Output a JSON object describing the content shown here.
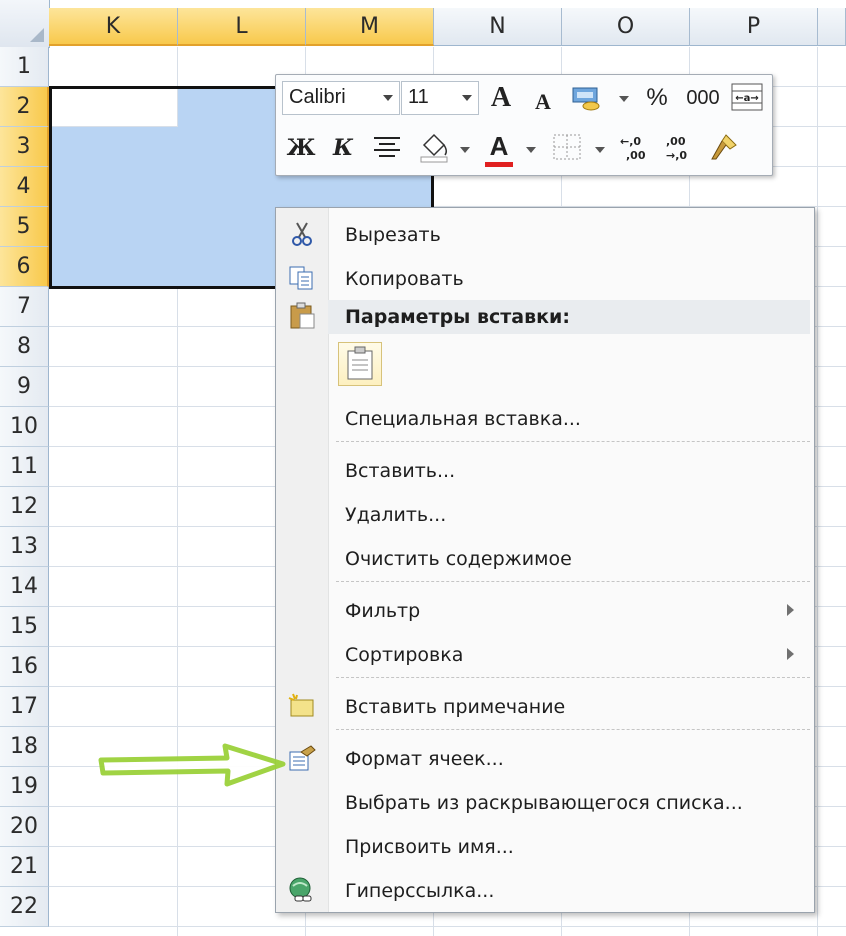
{
  "columns": [
    "K",
    "L",
    "M",
    "N",
    "O",
    "P"
  ],
  "rows": [
    "1",
    "2",
    "3",
    "4",
    "5",
    "6",
    "7",
    "8",
    "9",
    "10",
    "11",
    "12",
    "13",
    "14",
    "15",
    "16",
    "17",
    "18",
    "19",
    "20",
    "21",
    "22"
  ],
  "selected_columns": [
    "K",
    "L",
    "M"
  ],
  "selected_rows": [
    "2",
    "3",
    "4",
    "5",
    "6"
  ],
  "mini_toolbar": {
    "font_name": "Calibri",
    "font_size": "11",
    "bold": "Ж",
    "italic": "К",
    "percent": "%",
    "thousands": "000",
    "grow_font": "A",
    "shrink_font": "A",
    "font_color_letter": "A",
    "inc_decimal": "←,0 ,00",
    "dec_decimal": ",00 →,0"
  },
  "context_menu": {
    "cut": "Вырезать",
    "copy": "Копировать",
    "paste_options": "Параметры вставки:",
    "paste_special": "Специальная вставка...",
    "insert": "Вставить...",
    "delete": "Удалить...",
    "clear_contents": "Очистить содержимое",
    "filter": "Фильтр",
    "sort": "Сортировка",
    "insert_comment": "Вставить примечание",
    "format_cells": "Формат ячеек...",
    "pick_from_list": "Выбрать из раскрывающегося списка...",
    "define_name": "Присвоить имя...",
    "hyperlink": "Гиперссылка..."
  },
  "colors": {
    "selection_fill": "#b9d4f3",
    "header_selected": "#f8c94c",
    "arrow_green": "#9bd13a",
    "font_color_bar": "#e02020"
  }
}
